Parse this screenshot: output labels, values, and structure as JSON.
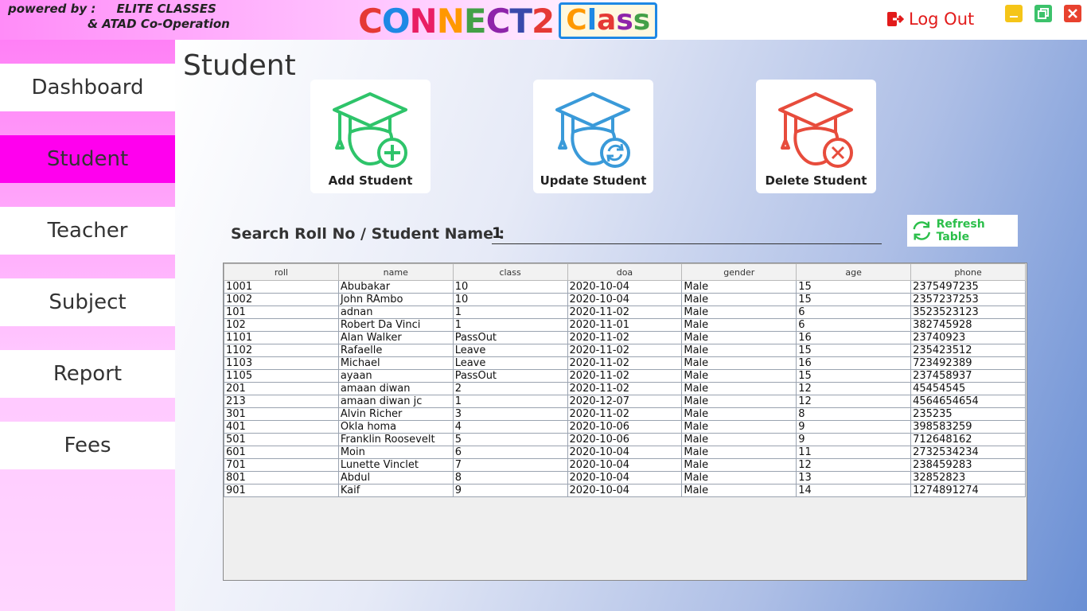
{
  "header": {
    "powered_line1": "powered by :     ELITE CLASSES",
    "powered_line2": "& ATAD Co-Operation",
    "logo_connect": [
      "C",
      "O",
      "N",
      "N",
      "E",
      "C",
      "T",
      "2"
    ],
    "logo_class": [
      "C",
      "l",
      "a",
      "s",
      "s"
    ],
    "logout_label": "Log Out"
  },
  "sidebar": {
    "items": [
      {
        "label": "Dashboard"
      },
      {
        "label": "Student"
      },
      {
        "label": "Teacher"
      },
      {
        "label": "Subject"
      },
      {
        "label": "Report"
      },
      {
        "label": "Fees"
      }
    ],
    "active": "Student"
  },
  "main": {
    "title": "Student",
    "actions": [
      {
        "label": "Add Student",
        "icon": "graduate-add-icon",
        "color": "#2ec46a"
      },
      {
        "label": "Update Student",
        "icon": "graduate-update-icon",
        "color": "#3a9ad9"
      },
      {
        "label": "Delete Student",
        "icon": "graduate-delete-icon",
        "color": "#e74c3c"
      }
    ],
    "search_label": "Search Roll No / Student Name :",
    "search_value": "1",
    "refresh_label": "Refresh Table"
  },
  "table": {
    "columns": [
      "roll",
      "name",
      "class",
      "doa",
      "gender",
      "age",
      "phone"
    ],
    "rows": [
      [
        "1001",
        "Abubakar",
        "10",
        "2020-10-04",
        "Male",
        "15",
        "2375497235"
      ],
      [
        "1002",
        "John RAmbo",
        "10",
        "2020-10-04",
        "Male",
        "15",
        "2357237253"
      ],
      [
        "101",
        "adnan",
        "1",
        "2020-11-02",
        "Male",
        "6",
        "3523523123"
      ],
      [
        "102",
        "Robert Da Vinci",
        "1",
        "2020-11-01",
        "Male",
        "6",
        "382745928"
      ],
      [
        "1101",
        "Alan Walker",
        "PassOut",
        "2020-11-02",
        "Male",
        "16",
        "23740923"
      ],
      [
        "1102",
        "Rafaelle",
        "Leave",
        "2020-11-02",
        "Male",
        "15",
        "235423512"
      ],
      [
        "1103",
        "Michael",
        "Leave",
        "2020-11-02",
        "Male",
        "16",
        "723492389"
      ],
      [
        "1105",
        "ayaan",
        "PassOut",
        "2020-11-02",
        "Male",
        "15",
        "237458937"
      ],
      [
        "201",
        "amaan diwan",
        "2",
        "2020-11-02",
        "Male",
        "12",
        "45454545"
      ],
      [
        "213",
        "amaan diwan jc",
        "1",
        "2020-12-07",
        "Male",
        "12",
        "4564654654"
      ],
      [
        "301",
        "Alvin Richer",
        "3",
        "2020-11-02",
        "Male",
        "8",
        "235235"
      ],
      [
        "401",
        "Okla homa",
        "4",
        "2020-10-06",
        "Male",
        "9",
        "398583259"
      ],
      [
        "501",
        "Franklin Roosevelt",
        "5",
        "2020-10-06",
        "Male",
        "9",
        "712648162"
      ],
      [
        "601",
        "Moin",
        "6",
        "2020-10-04",
        "Male",
        "11",
        "2732534234"
      ],
      [
        "701",
        "Lunette Vinclet",
        "7",
        "2020-10-04",
        "Male",
        "12",
        "238459283"
      ],
      [
        "801",
        "Abdul",
        "8",
        "2020-10-04",
        "Male",
        "13",
        "32852823"
      ],
      [
        "901",
        "Kaif",
        "9",
        "2020-10-04",
        "Male",
        "14",
        "1274891274"
      ]
    ]
  }
}
